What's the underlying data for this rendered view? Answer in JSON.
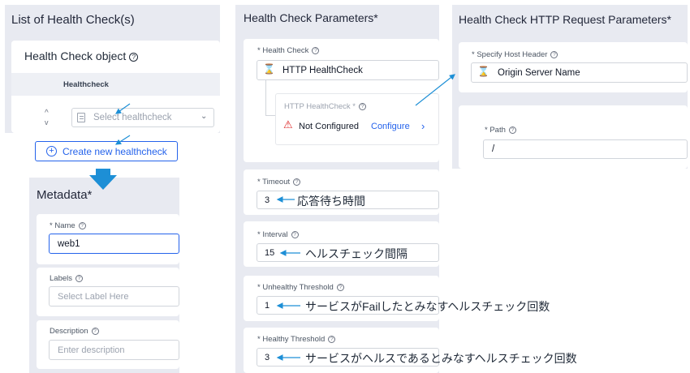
{
  "panel1": {
    "title": "List of Health Check(s)",
    "object_title": "Health Check object",
    "column_header": "Healthcheck",
    "sort_up": "^",
    "sort_down": "v",
    "select_placeholder": "Select healthcheck",
    "create_button": "Create new healthcheck"
  },
  "metadata": {
    "title": "Metadata",
    "required_mark": "*",
    "name_label": "* Name",
    "name_value": "web1",
    "labels_label": "Labels",
    "labels_placeholder": "Select Label Here",
    "description_label": "Description",
    "description_placeholder": "Enter description"
  },
  "panel2": {
    "title": "Health Check Parameters",
    "required_mark": "*",
    "health_check_label": "* Health Check",
    "health_check_value": "HTTP HealthCheck",
    "sub_label": "HTTP HealthCheck *",
    "status_text": "Not Configured",
    "configure_link": "Configure",
    "timeout_label": "* Timeout",
    "timeout_value": "3",
    "timeout_note": "応答待ち時間",
    "interval_label": "* Interval",
    "interval_value": "15",
    "interval_note": "ヘルスチェック間隔",
    "unhealthy_label": "* Unhealthy Threshold",
    "unhealthy_value": "1",
    "unhealthy_note": "サービスがFailしたとみなすヘルスチェック回数",
    "healthy_label": "* Healthy Threshold",
    "healthy_value": "3",
    "healthy_note": "サービスがヘルスであるとみなすヘルスチェック回数"
  },
  "panel3": {
    "title": "Health Check HTTP Request Parameters",
    "required_mark": "*",
    "host_label": "* Specify Host Header",
    "host_value": "Origin Server Name",
    "path_label": "* Path",
    "path_value": "/"
  },
  "colors": {
    "accent": "#2563eb",
    "annotation": "#1d8fd6",
    "panel_bg": "#e8eaf1",
    "warning": "#dc2626"
  }
}
